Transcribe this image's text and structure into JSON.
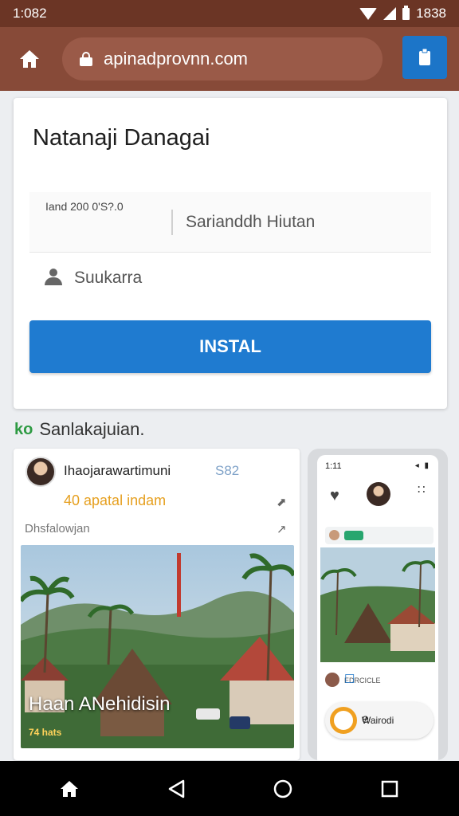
{
  "status_bar": {
    "time": "1:082",
    "right_text": "1838",
    "icons": [
      "wifi-icon",
      "signal-icon",
      "battery-icon"
    ]
  },
  "browser": {
    "url": "apinadprovnn.com",
    "icons": [
      "home-icon",
      "lock-icon",
      "clipboard-icon"
    ]
  },
  "form": {
    "title": "Natanaji Danagai",
    "date_field": "Iand 200 0'S?.0",
    "search_placeholder": "Sarianddh Hiutan",
    "user_placeholder": "Suukarra",
    "install_label": "INSTAL"
  },
  "section": {
    "icon_text": "ko",
    "label": "Sanlakajuian."
  },
  "post": {
    "author": "Ihaojarawartimuni",
    "count": "S82",
    "meta": "40 apatal indam",
    "subtitle": "Dhsfalowjan",
    "photo_caption": "Haan ANehidisin",
    "photo_subcaption": "74 hats"
  },
  "phone": {
    "time": "1:11",
    "user_label": "EDRCICLE",
    "pill_label": "Wairodi",
    "pill_letter": "e"
  },
  "nav": {
    "icons": [
      "home-icon",
      "back-icon",
      "home-circle-icon",
      "recents-icon"
    ]
  },
  "colors": {
    "status_bar": "#6b3525",
    "browser_bar": "#874a38",
    "accent_blue": "#1f7bd0",
    "meta_orange": "#e6a020",
    "section_green": "#2e9a43"
  }
}
